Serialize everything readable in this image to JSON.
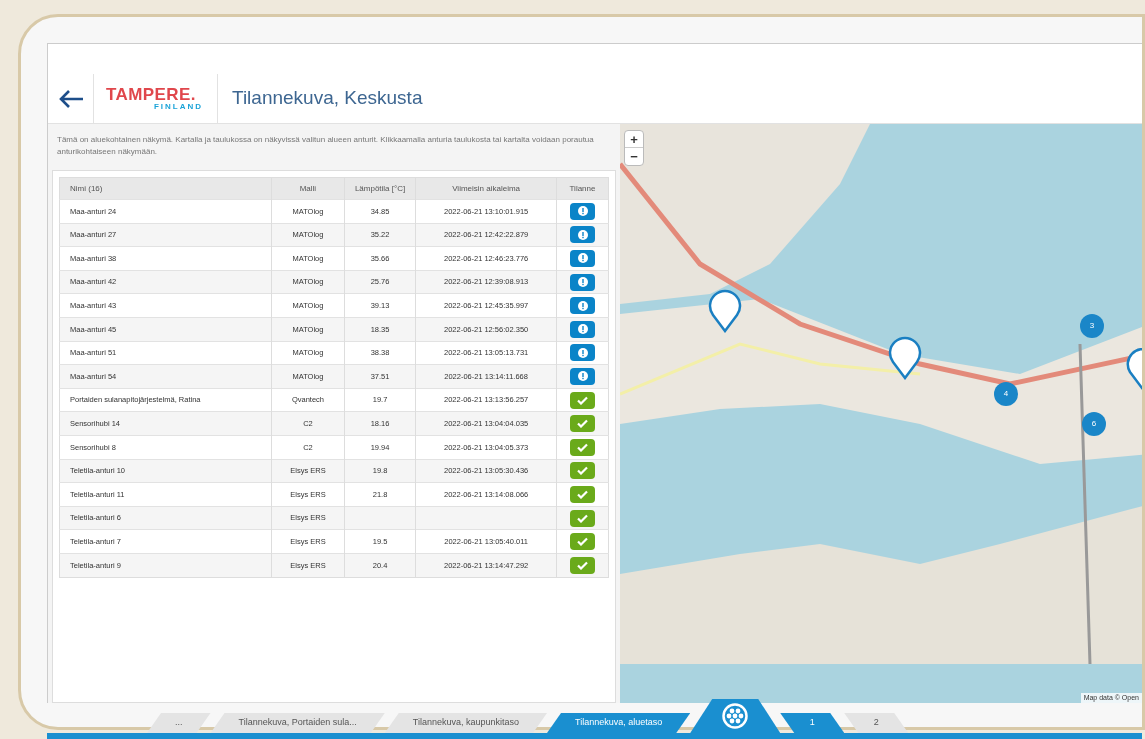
{
  "header": {
    "logo_main": "TAMPERE.",
    "logo_sub": "FINLAND",
    "title": "Tilannekuva, Keskusta"
  },
  "intro": "Tämä on aluekohtainen näkymä. Kartalla ja taulukossa on näkyvissä valitun alueen anturit. Klikkaamalla anturia taulukosta tai kartalta voidaan porautua anturikohtaiseen näkymään.",
  "table": {
    "columns": [
      "Nimi (16)",
      "Malli",
      "Lämpötila [°C]",
      "Viimeisin aikaleima",
      "Tilanne"
    ],
    "rows": [
      {
        "name": "Maa-anturi 24",
        "model": "MATOlog",
        "temp": "34.85",
        "time": "2022-06-21 13:10:01.915",
        "kind": "alert"
      },
      {
        "name": "Maa-anturi 27",
        "model": "MATOlog",
        "temp": "35.22",
        "time": "2022-06-21 12:42:22.879",
        "kind": "alert"
      },
      {
        "name": "Maa-anturi 38",
        "model": "MATOlog",
        "temp": "35.66",
        "time": "2022-06-21 12:46:23.776",
        "kind": "alert"
      },
      {
        "name": "Maa-anturi 42",
        "model": "MATOlog",
        "temp": "25.76",
        "time": "2022-06-21 12:39:08.913",
        "kind": "alert"
      },
      {
        "name": "Maa-anturi 43",
        "model": "MATOlog",
        "temp": "39.13",
        "time": "2022-06-21 12:45:35.997",
        "kind": "alert"
      },
      {
        "name": "Maa-anturi 45",
        "model": "MATOlog",
        "temp": "18.35",
        "time": "2022-06-21 12:56:02.350",
        "kind": "alert"
      },
      {
        "name": "Maa-anturi 51",
        "model": "MATOlog",
        "temp": "38.38",
        "time": "2022-06-21 13:05:13.731",
        "kind": "alert"
      },
      {
        "name": "Maa-anturi 54",
        "model": "MATOlog",
        "temp": "37.51",
        "time": "2022-06-21 13:14:11.668",
        "kind": "alert"
      },
      {
        "name": "Portaiden sulanapitojärjestelmä, Ratina",
        "model": "Qvantech",
        "temp": "19.7",
        "time": "2022-06-21 13:13:56.257",
        "kind": "ok"
      },
      {
        "name": "Sensorihubi 14",
        "model": "C2",
        "temp": "18.16",
        "time": "2022-06-21 13:04:04.035",
        "kind": "ok"
      },
      {
        "name": "Sensorihubi 8",
        "model": "C2",
        "temp": "19.94",
        "time": "2022-06-21 13:04:05.373",
        "kind": "ok"
      },
      {
        "name": "Teletila-anturi 10",
        "model": "Elsys ERS",
        "temp": "19.8",
        "time": "2022-06-21 13:05:30.436",
        "kind": "ok"
      },
      {
        "name": "Teletila-anturi 11",
        "model": "Elsys ERS",
        "temp": "21.8",
        "time": "2022-06-21 13:14:08.066",
        "kind": "ok"
      },
      {
        "name": "Teletila-anturi 6",
        "model": "Elsys ERS",
        "kind": "ok"
      },
      {
        "name": "Teletila-anturi 7",
        "model": "Elsys ERS",
        "temp": "19.5",
        "time": "2022-06-21 13:05:40.011",
        "kind": "ok"
      },
      {
        "name": "Teletila-anturi 9",
        "model": "Elsys ERS",
        "temp": "20.4",
        "time": "2022-06-21 13:14:47.292",
        "kind": "ok"
      }
    ]
  },
  "map": {
    "zoom_in": "+",
    "zoom_out": "−",
    "clusters": [
      "3",
      "4",
      "6"
    ],
    "attribution": "Map data © Open"
  },
  "breadcrumbs": [
    {
      "label": "...",
      "selected": false
    },
    {
      "label": "Tilannekuva, Portaiden sula...",
      "selected": false
    },
    {
      "label": "Tilannekuva, kaupunkitaso",
      "selected": false
    },
    {
      "label": "Tilannekuva, aluetaso",
      "selected": true
    }
  ],
  "pages": [
    {
      "label": "1",
      "selected": true
    },
    {
      "label": "2",
      "selected": false
    }
  ]
}
